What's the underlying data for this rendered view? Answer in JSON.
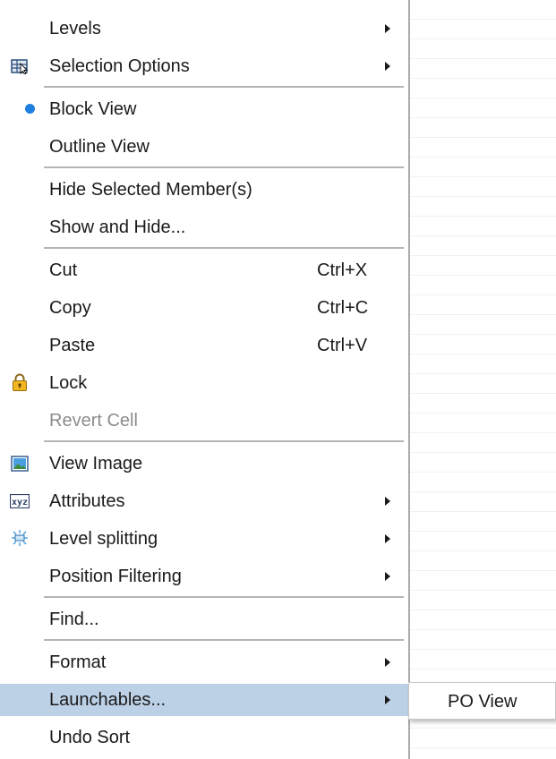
{
  "menu": {
    "items": [
      {
        "label": "Levels",
        "arrow": true
      },
      {
        "label": "Selection Options",
        "arrow": true,
        "icon": "selection-options-icon"
      },
      {
        "label": "Block View",
        "checked": true
      },
      {
        "label": "Outline View"
      },
      {
        "label": "Hide Selected Member(s)"
      },
      {
        "label": "Show and Hide..."
      },
      {
        "label": "Cut",
        "shortcut": "Ctrl+X"
      },
      {
        "label": "Copy",
        "shortcut": "Ctrl+C"
      },
      {
        "label": "Paste",
        "shortcut": "Ctrl+V"
      },
      {
        "label": "Lock",
        "icon": "lock-icon"
      },
      {
        "label": "Revert Cell",
        "disabled": true
      },
      {
        "label": "View Image",
        "icon": "image-icon"
      },
      {
        "label": "Attributes",
        "arrow": true,
        "icon": "xyz-attributes-icon"
      },
      {
        "label": "Level splitting",
        "arrow": true,
        "icon": "level-splitting-icon"
      },
      {
        "label": "Position Filtering",
        "arrow": true
      },
      {
        "label": "Find..."
      },
      {
        "label": "Format",
        "arrow": true
      },
      {
        "label": "Launchables...",
        "arrow": true,
        "highlighted": true
      },
      {
        "label": "Undo Sort"
      }
    ]
  },
  "submenu": {
    "items": [
      {
        "label": "PO View"
      }
    ]
  },
  "colors": {
    "highlight": "#bcd0e6",
    "radio_dot": "#1e7fe0",
    "disabled_text": "#8c8c8c"
  }
}
